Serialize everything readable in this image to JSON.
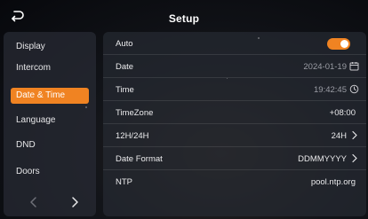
{
  "header": {
    "title": "Setup",
    "back_icon": "back-arrow-icon"
  },
  "sidebar": {
    "items": [
      {
        "label": "Display"
      },
      {
        "label": "Intercom"
      },
      {
        "label": "Date & Time",
        "active": true
      },
      {
        "label": "Language"
      },
      {
        "label": "DND"
      },
      {
        "label": "Doors"
      }
    ],
    "pager": {
      "prev_icon": "chevron-left-icon",
      "next_icon": "chevron-right-icon"
    }
  },
  "settings": {
    "rows": [
      {
        "label": "Auto",
        "control": "toggle",
        "toggle_on": true
      },
      {
        "label": "Date",
        "value": "2024-01-19",
        "icon": "calendar-icon"
      },
      {
        "label": "Time",
        "value": "19:42:45",
        "icon": "clock-icon"
      },
      {
        "label": "TimeZone",
        "value": "+08:00"
      },
      {
        "label": "12H/24H",
        "value": "24H",
        "icon": "chevron-right-icon"
      },
      {
        "label": "Date Format",
        "value": "DDMMYYYY",
        "icon": "chevron-right-icon"
      },
      {
        "label": "NTP",
        "value": "pool.ntp.org"
      }
    ]
  },
  "colors": {
    "accent": "#f08322",
    "panel": "#262932",
    "text": "#e8e8ea",
    "dim_text": "#9a9ca4"
  }
}
